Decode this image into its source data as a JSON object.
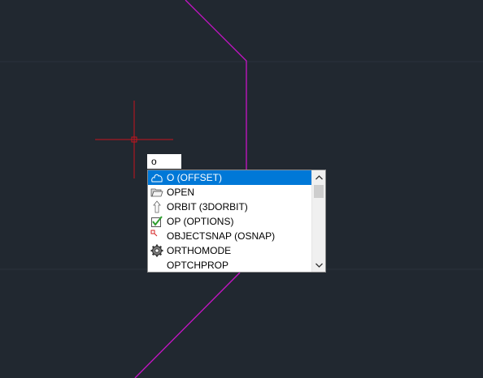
{
  "command_line": {
    "typed_text": "o"
  },
  "autocomplete": {
    "items": [
      {
        "label": "O (OFFSET)",
        "icon": "offset-icon",
        "selected": true
      },
      {
        "label": "OPEN",
        "icon": "open-folder-icon",
        "selected": false
      },
      {
        "label": "ORBIT (3DORBIT)",
        "icon": "orbit-icon",
        "selected": false
      },
      {
        "label": "OP (OPTIONS)",
        "icon": "options-checkbox-icon",
        "selected": false
      },
      {
        "label": "OBJECTSNAP (OSNAP)",
        "icon": "object-snap-icon",
        "selected": false
      },
      {
        "label": "ORTHOMODE",
        "icon": "gear-icon",
        "selected": false
      },
      {
        "label": "OPTCHPROP",
        "icon": "",
        "selected": false
      }
    ]
  },
  "colors": {
    "background": "#212830",
    "crosshair": "#c8141e",
    "polyline": "#c814c8",
    "selection": "#0078d7"
  }
}
